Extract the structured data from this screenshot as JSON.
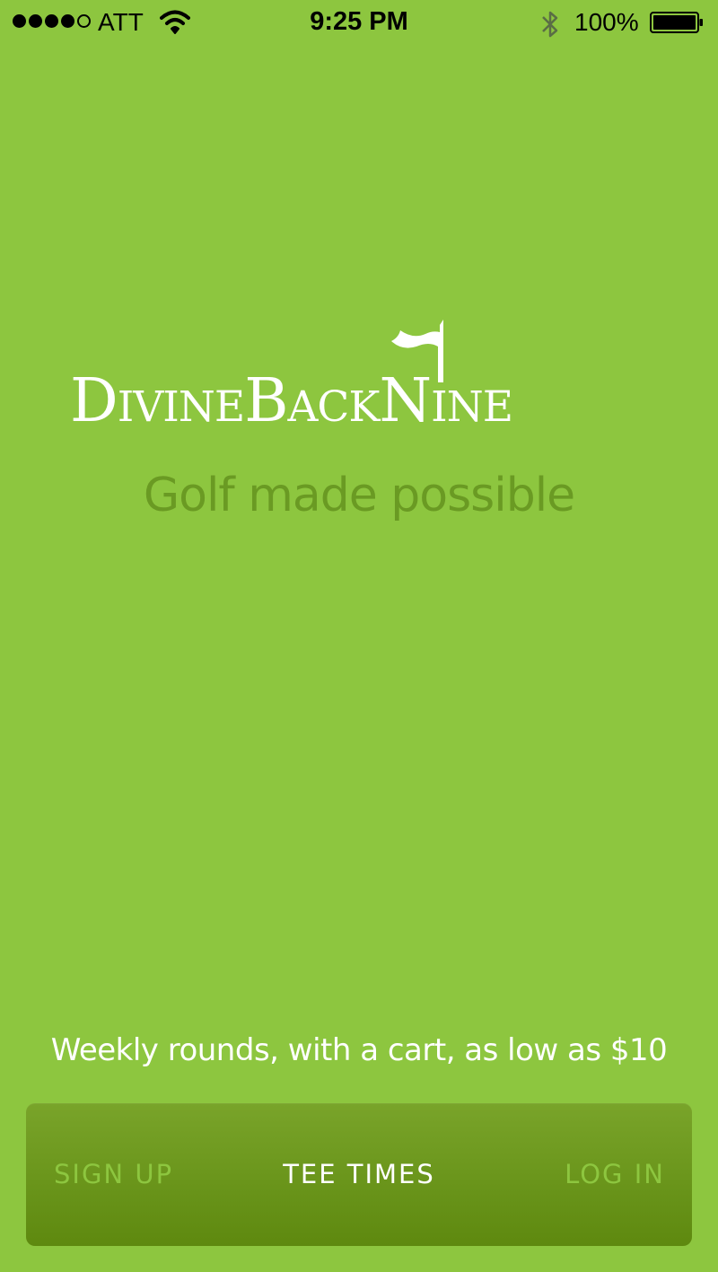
{
  "status_bar": {
    "carrier": "ATT",
    "time": "9:25 PM",
    "battery_percent": "100%",
    "signal_bars_filled": 4,
    "signal_bars_total": 5,
    "icons": [
      "signal-icon",
      "wifi-icon",
      "bluetooth-icon",
      "battery-icon"
    ]
  },
  "brand": {
    "logo_text": "DivineBackNine",
    "tagline": "Golf made possible"
  },
  "promo": {
    "text": "Weekly rounds, with a cart, as low as $10"
  },
  "nav": {
    "sign_up": "SIGN UP",
    "tee_times": "TEE TIMES",
    "log_in": "LOG IN",
    "active": "TEE TIMES"
  },
  "colors": {
    "background": "#8dc63f",
    "tagline": "#6a9a23",
    "nav_bar_top": "#79a42a",
    "nav_bar_bottom": "#5e890f",
    "nav_inactive": "#8dc63f",
    "nav_active": "#ffffff"
  }
}
